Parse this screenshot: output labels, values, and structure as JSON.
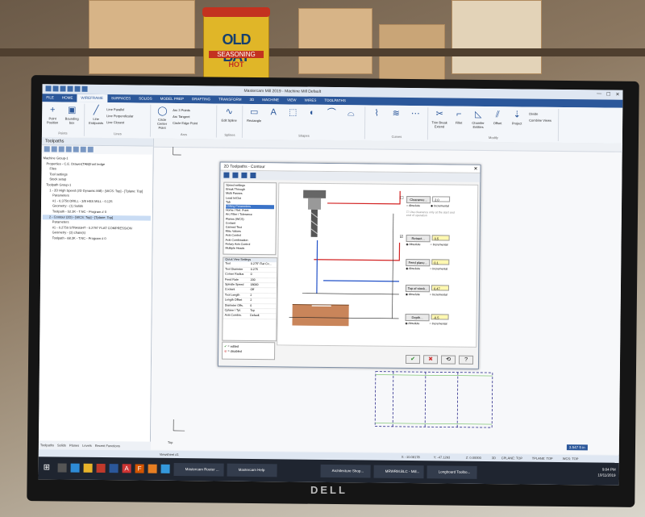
{
  "physical": {
    "can_brand": "OLD BAY",
    "can_sub": "SEASONING",
    "can_hot": "HOT",
    "monitor_brand": "DELL"
  },
  "app": {
    "title": "Mastercam Mill 2019 - Machine Mill Default",
    "ribbon_tabs": [
      "FILE",
      "HOME",
      "WIREFRAME",
      "SURFACES",
      "SOLIDS",
      "MODEL PREP",
      "DRAFTING",
      "TRANSFORM",
      "3D",
      "MACHINE",
      "VIEW",
      "WIRES",
      "TOOLPATHS"
    ],
    "active_tab": "WIREFRAME",
    "ribbon": {
      "points_label": "Point Position",
      "spline_label": "Bounding box",
      "line_endpoints": "Line Endpoints",
      "circle_center": "Circle Center Point",
      "rectangle": "Rectangle",
      "shapes_group": "Shapes",
      "points_group": "Points",
      "lines_group": "Lines",
      "arcs_group": "Arcs",
      "splines_group": "Splines",
      "curves_group": "Curves",
      "modify_group": "Modify",
      "line_parallel": "Line Parallel",
      "line_perpendicular": "Line Perpendicular",
      "line_closest": "Line Closest",
      "arc_3point": "Arc 3 Points",
      "arc_tangent": "Arc Tangent",
      "circle_edge": "Circle Edge Point",
      "trim_break": "Trim Break Extend",
      "fillet": "Fillet",
      "chamfer": "Chamfer Entities",
      "offset": "Offset",
      "project": "Project",
      "divide": "Divide",
      "combine_views": "Combine Views",
      "edit_spline": "Edit Spline"
    }
  },
  "left_panel": {
    "title": "Toolpaths",
    "tree": [
      "Machine Group-1",
      "Properties - C.E. Drawer(TAB)front ledge",
      "Files",
      "Tool settings",
      "Stock setup",
      "Toolpath Group-1",
      "1 - 2D High Speed (2D Dynamic Mill) - [WCS: Top] - [Tplane: Top]",
      "Parameters",
      "#1 - 0.3750 DRILL - 3/8 HSS MILL - 0.125",
      "Geometry - (1) Solids",
      "Toolpath - 52.3K - T.NC - Program # 0",
      "2 - Contour (2D) - [WCS: Top] - [Tplane: Top]",
      "Parameters",
      "#1 - 0.2750 STRAIGHT - 0.2797 FLAT COMPRESSION",
      "Geometry - (3) chain(s)",
      "Toolpath - 68.3K - T.NC - Program # 0"
    ],
    "bottom_tabs": [
      "Toolpaths",
      "Solids",
      "Planes",
      "Levels",
      "Recent Functions"
    ]
  },
  "dialog": {
    "title": "2D Toolpaths - Contour",
    "pages": [
      "Speed settings",
      "Break Through",
      "Multi Passes",
      "Lead In/Out",
      "Tab",
      "Linking Parameters",
      "Home / Ref. Point",
      "Arc Filter / Tolerance",
      "Planes (WCS)",
      "Coolant",
      "Canned Text",
      "Misc Values",
      "Axis Control",
      "Axis Combination",
      "Rotary Axis Control",
      "Multiple Heads"
    ],
    "selected_page": "Linking Parameters",
    "quick_view_title": "Quick View Settings",
    "quick_view": [
      [
        "Tool",
        "0.275\" Flat Co..."
      ],
      [
        "Tool Diameter",
        "0.275"
      ],
      [
        "Corner Radius",
        "0"
      ],
      [
        "Feed Rate",
        "200"
      ],
      [
        "Spindle Speed",
        "18000"
      ],
      [
        "Coolant",
        "Off"
      ],
      [
        "Tool Length",
        "2"
      ],
      [
        "Length Offset",
        "2"
      ],
      [
        "Diameter Offs.",
        "0"
      ],
      [
        "Cplane / Tpl.",
        "Top"
      ],
      [
        "Axis Combin.",
        "Default"
      ]
    ],
    "legend": [
      "= edited",
      "= disabled"
    ],
    "fields": {
      "clearance": {
        "label": "Clearance...",
        "value": "2.0",
        "opt1": "Absolute",
        "opt2": "Incremental",
        "note": "Use clearance only at the start and end of operation"
      },
      "retract": {
        "label": "Retract...",
        "value": "0.5",
        "opt1": "Absolute",
        "opt2": "Incremental"
      },
      "feed_plane": {
        "label": "Feed plane...",
        "value": "0.1",
        "opt1": "Absolute",
        "opt2": "Incremental"
      },
      "top_of_stock": {
        "label": "Top of stock...",
        "value": "0.47",
        "opt1": "Absolute",
        "opt2": "Incremental"
      },
      "depth": {
        "label": "Depth...",
        "value": "-0.5",
        "opt1": "Absolute",
        "opt2": "Incremental"
      }
    },
    "buttons": [
      "✔",
      "✖",
      "⟲",
      "?"
    ]
  },
  "status_bar": {
    "x": "X: -10.09178",
    "y": "Y: -47.1293",
    "z": "Z: 0.00000",
    "mode": "3D",
    "cplane": "CPLANE: TOP",
    "tplane": "TPLANE: TOP",
    "wcs": "WCS: TOP",
    "view": "Top",
    "dimension": "3.547 ft in",
    "viewsheet": "Viewsheet #1"
  },
  "taskbar": {
    "items": [
      "Mastercam Router ...",
      "Mastercam Help",
      "Architecture Shop...",
      "MRWRM.BLC - Mill...",
      "Longboard Toolbo..."
    ],
    "time": "9:04 PM",
    "date": "10/11/2019"
  },
  "colors": {
    "accent": "#2b579a",
    "retract_line": "#d32222",
    "feed_line": "#2050c8",
    "field_yellow": "#fff8b0"
  }
}
